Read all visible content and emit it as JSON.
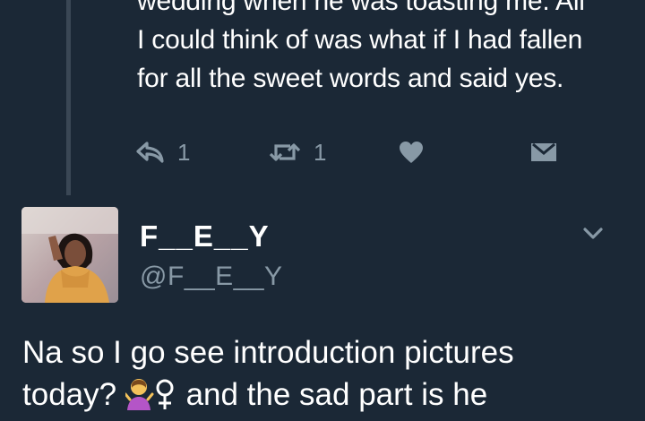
{
  "previous_tweet": {
    "text_lines": [
      "wedding when he was toasting me. All",
      "I could think of was what if I had fallen",
      "for all the sweet words and said yes."
    ],
    "reply_count": "1",
    "retweet_count": "1",
    "icons": {
      "reply": "reply-icon",
      "retweet": "retweet-icon",
      "like": "heart-icon",
      "dm": "envelope-icon"
    }
  },
  "tweet": {
    "display_name": "F__E__Y",
    "handle": "@F__E__Y",
    "text_lines": [
      "Na so I go see introduction pictures",
      "today?",
      "and the sad part is he"
    ],
    "emoji": "person-shrugging-emoji",
    "icons": {
      "menu": "chevron-down-icon"
    }
  },
  "colors": {
    "background": "#1b2836",
    "text": "#ffffff",
    "muted": "#8899a6",
    "thread_line": "#3a4755"
  }
}
